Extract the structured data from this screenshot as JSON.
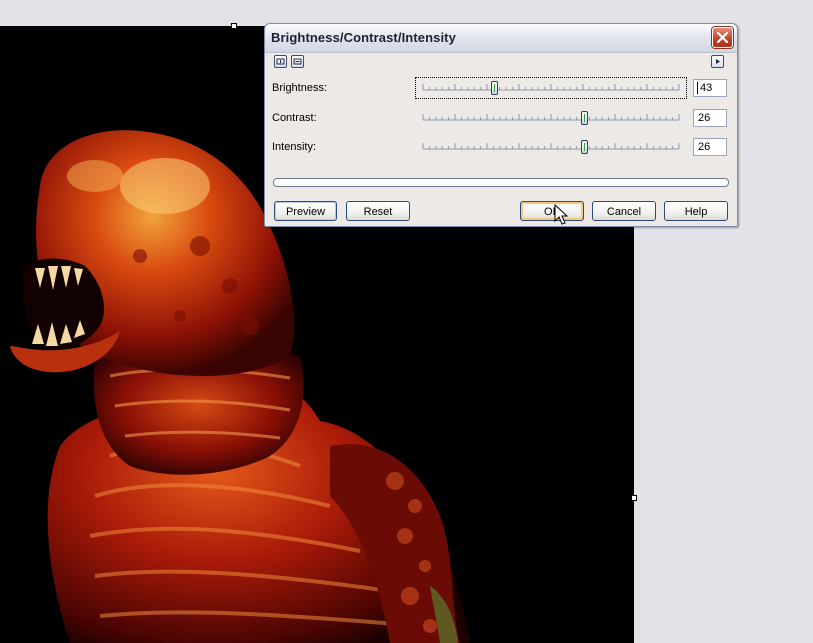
{
  "dialog": {
    "title": "Brightness/Contrast/Intensity",
    "rows": [
      {
        "label": "Brightness:",
        "value": "43"
      },
      {
        "label": "Contrast:",
        "value": "26"
      },
      {
        "label": "Intensity:",
        "value": "26"
      }
    ],
    "slider_levels": {
      "brightness": 0.28,
      "contrast": 0.63,
      "intensity": 0.63
    },
    "buttons": {
      "preview": "Preview",
      "reset": "Reset",
      "ok": "OK",
      "cancel": "Cancel",
      "help": "Help"
    }
  },
  "icons": {
    "close": "close-icon",
    "expand": "expand-icon",
    "collapse": "collapse-icon",
    "menu_arrow": "arrow-right-icon",
    "slider_thumb": "slider-thumb-icon",
    "cursor": "mouse-pointer-icon"
  },
  "colors": {
    "canvas_background": "#000000",
    "workspace_background": "#e3e2e8",
    "dialog_background": "#ece9e6",
    "close_button": "#c5432a",
    "default_button_highlight": "#f4c77c"
  }
}
